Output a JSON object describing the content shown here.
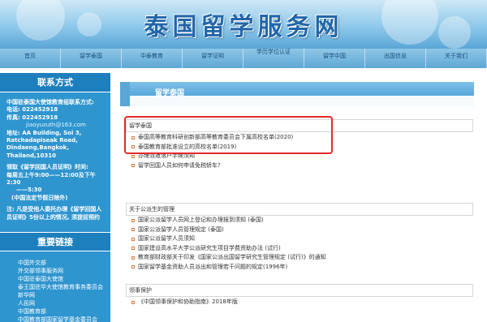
{
  "header": {
    "site_title": "泰国留学服务网"
  },
  "nav": {
    "items": [
      "首页",
      "留学泰国",
      "中泰教育",
      "留学证明",
      "学历学位认证",
      "留学中国",
      "出国信息",
      "关于我们"
    ]
  },
  "sidebar": {
    "contact_title": "联系方式",
    "org": "中国驻泰国大使馆教育组联系方式:",
    "phone": "电话: 022452918",
    "fax": "传真: 022452918",
    "email": "jiaoyuzuth@163.com",
    "address_lines": [
      "地址: AA Building, Soi 3,",
      "Ratchadapiseak Road,",
      "Dindaeng,Bangkok, Thailand,10310"
    ],
    "cert_lines": [
      "领取《留学回国人员证明》时间:",
      "每周五上午9:00——12:00及下午2:30",
      "——5:30",
      "(中国法定节假日除外)"
    ],
    "note_lines": [
      "注: 凡是受他人委托办理《留学回国人",
      "员证明》5份以上的情况, 须提前预约"
    ],
    "links_title": "重要链接",
    "links": [
      "中国外交部",
      "外交部领事服务网",
      "中国驻泰国大使馆",
      "泰王国驻华大使馆教育事务委员会",
      "新华网",
      "人民网",
      "中国教育部",
      "中国教育部国家留学基金委员会"
    ]
  },
  "main": {
    "header_label": "留学泰国",
    "sections": [
      {
        "title": "留学泰国",
        "items": [
          "泰国高等教育科研创新部高等教育委员会下属高校名单(2020)",
          "泰国教育部批准设立的高校名单(2019)",
          "办理派遣落户手续须知",
          "留学回国人员如何申请免税轿车?"
        ]
      },
      {
        "title": "关于公派生的管理",
        "items": [
          "国家公派留学人员网上登记和办理报到须知 (泰国)",
          "国家公派留学人员管理规定 (泰国)",
          "国家公派留学人员须知",
          "国家建设高水平大学公派研究生项目学费资助办法 (试行)",
          "教育部财政部关于印发《国家公派出国留学研究生管理规定 (试行)》的通知",
          "国家留学基金资助人员派出和管理若干问题的规定(1996年)"
        ]
      },
      {
        "title": "领事保护",
        "items": [
          "《中国领事保护和协助指南》2018年版"
        ]
      }
    ]
  },
  "colors": {
    "nav_bg": "#5ea8d6",
    "sidebar_bg": "#2f95cf",
    "highlight_box": "#e32b2b",
    "bullet": "#e07a3a"
  }
}
